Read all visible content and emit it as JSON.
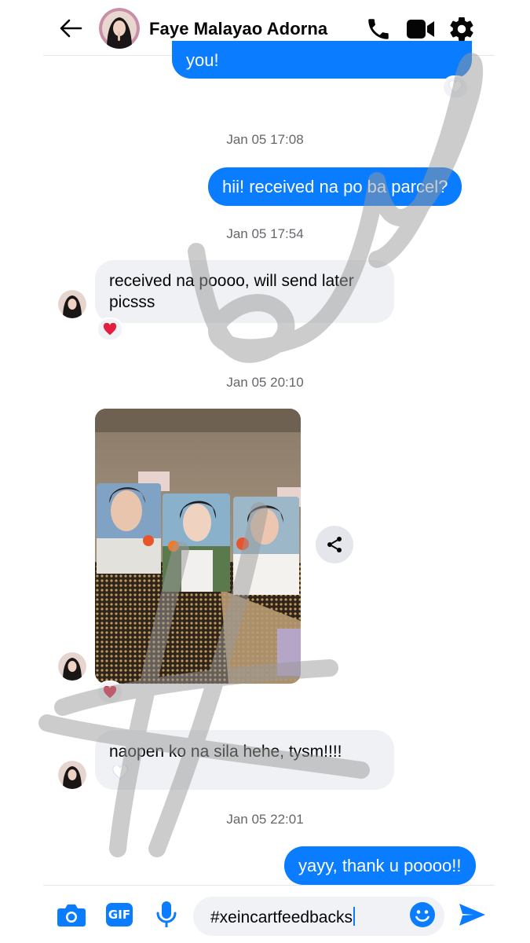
{
  "header": {
    "contact_name": "Faye Malayao Adorna",
    "icons": [
      "back-arrow-icon",
      "phone-icon",
      "video-camera-icon",
      "gear-icon"
    ]
  },
  "thread": {
    "messages": [
      {
        "id": "m1",
        "direction": "outgoing",
        "text": "you!",
        "reaction": "heart-outline"
      },
      {
        "id": "ts1",
        "type": "timestamp",
        "text": "Jan 05 17:08"
      },
      {
        "id": "m2",
        "direction": "outgoing",
        "text": "hii! received na po ba parcel?"
      },
      {
        "id": "ts2",
        "type": "timestamp",
        "text": "Jan 05 17:54"
      },
      {
        "id": "m3",
        "direction": "incoming",
        "text": "received na poooo, will send later picsss",
        "reaction": "red-heart"
      },
      {
        "id": "ts3",
        "type": "timestamp",
        "text": "Jan 05 20:10"
      },
      {
        "id": "m4",
        "direction": "incoming",
        "type": "photo",
        "reaction": "red-heart"
      },
      {
        "id": "m5",
        "direction": "incoming",
        "text": "naopen ko na sila hehe, tysm!!!!",
        "reaction": "heart-outline"
      },
      {
        "id": "ts4",
        "type": "timestamp",
        "text": "Jan 05 22:01"
      },
      {
        "id": "m6",
        "direction": "outgoing",
        "text": "yayy, thank u poooo!!"
      }
    ]
  },
  "composer": {
    "gif_label": "GIF",
    "input_value": "#xeincartfeedbacks",
    "icons": [
      "camera-icon",
      "gif-icon",
      "microphone-icon",
      "emoji-icon",
      "send-icon"
    ]
  },
  "colors": {
    "accent": "#0a7cff",
    "incoming_bubble": "#eff1f5",
    "timestamp": "#65676b",
    "heart": "#e41e3f"
  }
}
